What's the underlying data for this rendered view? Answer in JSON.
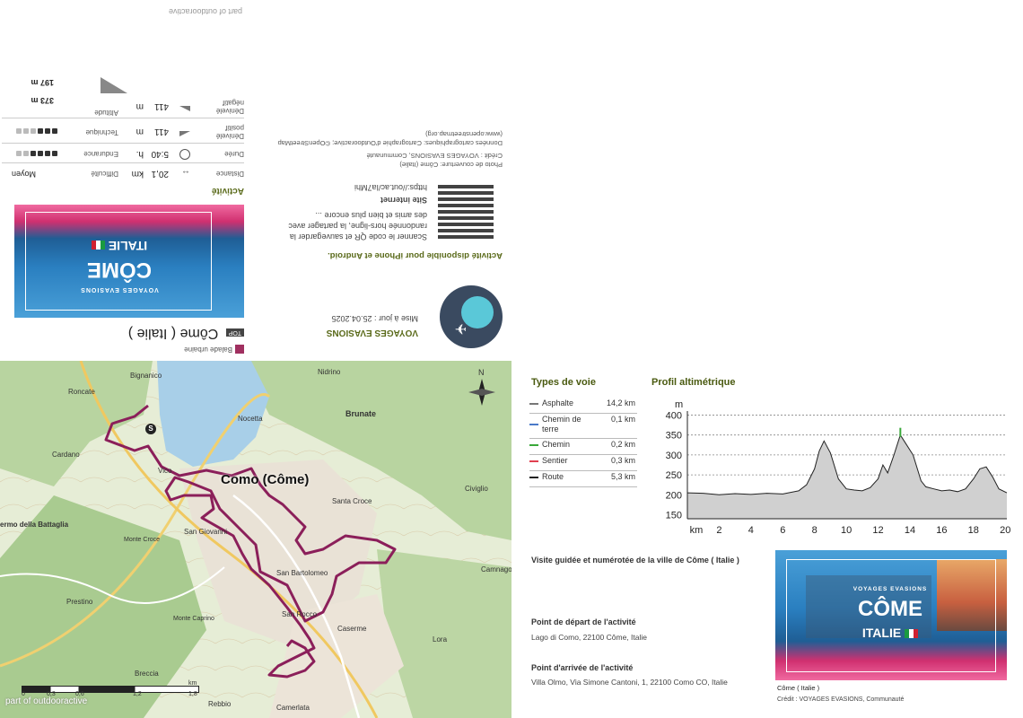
{
  "top": {
    "brand": "part of outdooractive",
    "badge_top": "TOP",
    "title": "Côme ( Italie )",
    "category": "Balade urbaine",
    "author": "VOYAGES EVASIONS",
    "updated": "Mise à jour : 25.04.2025",
    "app_title": "Activité disponible pour iPhone et Android.",
    "app_text_1": "Scanner le code QR et sauvegarder la",
    "app_text_2": "randonnée hors-ligne, la partager avec",
    "app_text_3": "des amis et bien plus encore ...",
    "site_label": "Site internet",
    "site_url": "https://out.ac/Ia7Mhi",
    "photo_credit": "Photo de couverture: Côme (Italie)",
    "photo_credit_2": "Crédit : VOYAGES EVASIONS, Communauté",
    "map_credit_1": "Données cartographiques: Cartographie d'Outdooractive; ©OpenStreetMap",
    "map_credit_2": "(www.openstreetmap.org)",
    "cover_title": "CÔME",
    "cover_sub": "ITALIE",
    "cover_small": "VOYAGES EVASIONS",
    "activity_label": "Activité",
    "stats": [
      {
        "label": "Distance",
        "value": "20,1",
        "unit": "km",
        "right_label": "Difficulté",
        "right_value": "Moyen"
      },
      {
        "label": "Durée",
        "value": "5:40",
        "unit": "h.",
        "right_label": "Endurance",
        "dots": 4
      },
      {
        "label": "Dénivelé positif",
        "value": "411",
        "unit": "m",
        "right_label": "Technique",
        "dots": 4
      },
      {
        "label": "Dénivelé négatif",
        "value": "411",
        "unit": "m",
        "right_label": "Altitude"
      }
    ],
    "alt_max": "373 m",
    "alt_min": "197 m"
  },
  "map": {
    "places": [
      "Bignanico",
      "Roncate",
      "Nidrino",
      "Brunate",
      "Nocetta",
      "Vico",
      "Como (Côme)",
      "Cardano",
      "Civiglio",
      "Santa Croce",
      "San Giovanni",
      "San Bartolomeo",
      "San Rocco",
      "Prestino",
      "Monte Croce",
      "Monte Caprino",
      "Breccia",
      "Caserme",
      "Camnago",
      "Lora",
      "Rebbio",
      "Camerlata",
      "ermo della Battaglia"
    ],
    "scale_ticks": [
      "0",
      "0,3",
      "0,6",
      "1,2",
      "1,8"
    ],
    "scale_unit": "km",
    "watermark": "part of outdooractive",
    "north": "N"
  },
  "voie": {
    "title": "Types de voie",
    "rows": [
      {
        "name": "Asphalte",
        "value": "14,2 km",
        "color": "#777777"
      },
      {
        "name": "Chemin de terre",
        "value": "0,1 km",
        "color": "#4a7ac8"
      },
      {
        "name": "Chemin",
        "value": "0,2 km",
        "color": "#3aa83a"
      },
      {
        "name": "Sentier",
        "value": "0,3 km",
        "color": "#e04050"
      },
      {
        "name": "Route",
        "value": "5,3 km",
        "color": "#222222"
      }
    ]
  },
  "profile": {
    "title": "Profil altimétrique",
    "unit_y": "m",
    "unit_x": "km"
  },
  "chart_data": {
    "type": "area",
    "title": "Profil altimétrique",
    "xlabel": "km",
    "ylabel": "m",
    "x_ticks": [
      2,
      4,
      6,
      8,
      10,
      12,
      14,
      16,
      18,
      20
    ],
    "y_ticks": [
      150,
      200,
      250,
      300,
      350,
      400
    ],
    "xlim": [
      0,
      20.1
    ],
    "ylim": [
      140,
      410
    ],
    "x": [
      0,
      1,
      2,
      3,
      4,
      5,
      6,
      7,
      7.5,
      8,
      8.3,
      8.6,
      9,
      9.5,
      10,
      10.5,
      11,
      11.5,
      12,
      12.3,
      12.6,
      13,
      13.4,
      13.8,
      14.2,
      14.7,
      15,
      15.5,
      16,
      16.5,
      17,
      17.5,
      18,
      18.4,
      18.8,
      19.2,
      19.6,
      20.1
    ],
    "y": [
      205,
      204,
      200,
      203,
      201,
      204,
      202,
      210,
      225,
      265,
      310,
      335,
      305,
      240,
      215,
      212,
      210,
      218,
      240,
      275,
      255,
      300,
      350,
      325,
      300,
      235,
      220,
      215,
      210,
      212,
      208,
      215,
      240,
      265,
      270,
      245,
      215,
      205
    ]
  },
  "info": {
    "desc": "Visite guidée et numérotée de la ville de Côme ( Italie )",
    "start_label": "Point de départ de l'activité",
    "start_value": "Lago di Como, 22100 Côme, Italie",
    "end_label": "Point d'arrivée de l'activité",
    "end_value": "Villa Olmo, Via Simone Cantoni, 1, 22100 Como CO, Italie"
  },
  "photo": {
    "small": "VOYAGES EVASIONS",
    "title": "CÔME",
    "sub": "ITALIE",
    "caption": "Côme ( Italie )",
    "credit": "Crédit : VOYAGES EVASIONS, Communauté"
  }
}
